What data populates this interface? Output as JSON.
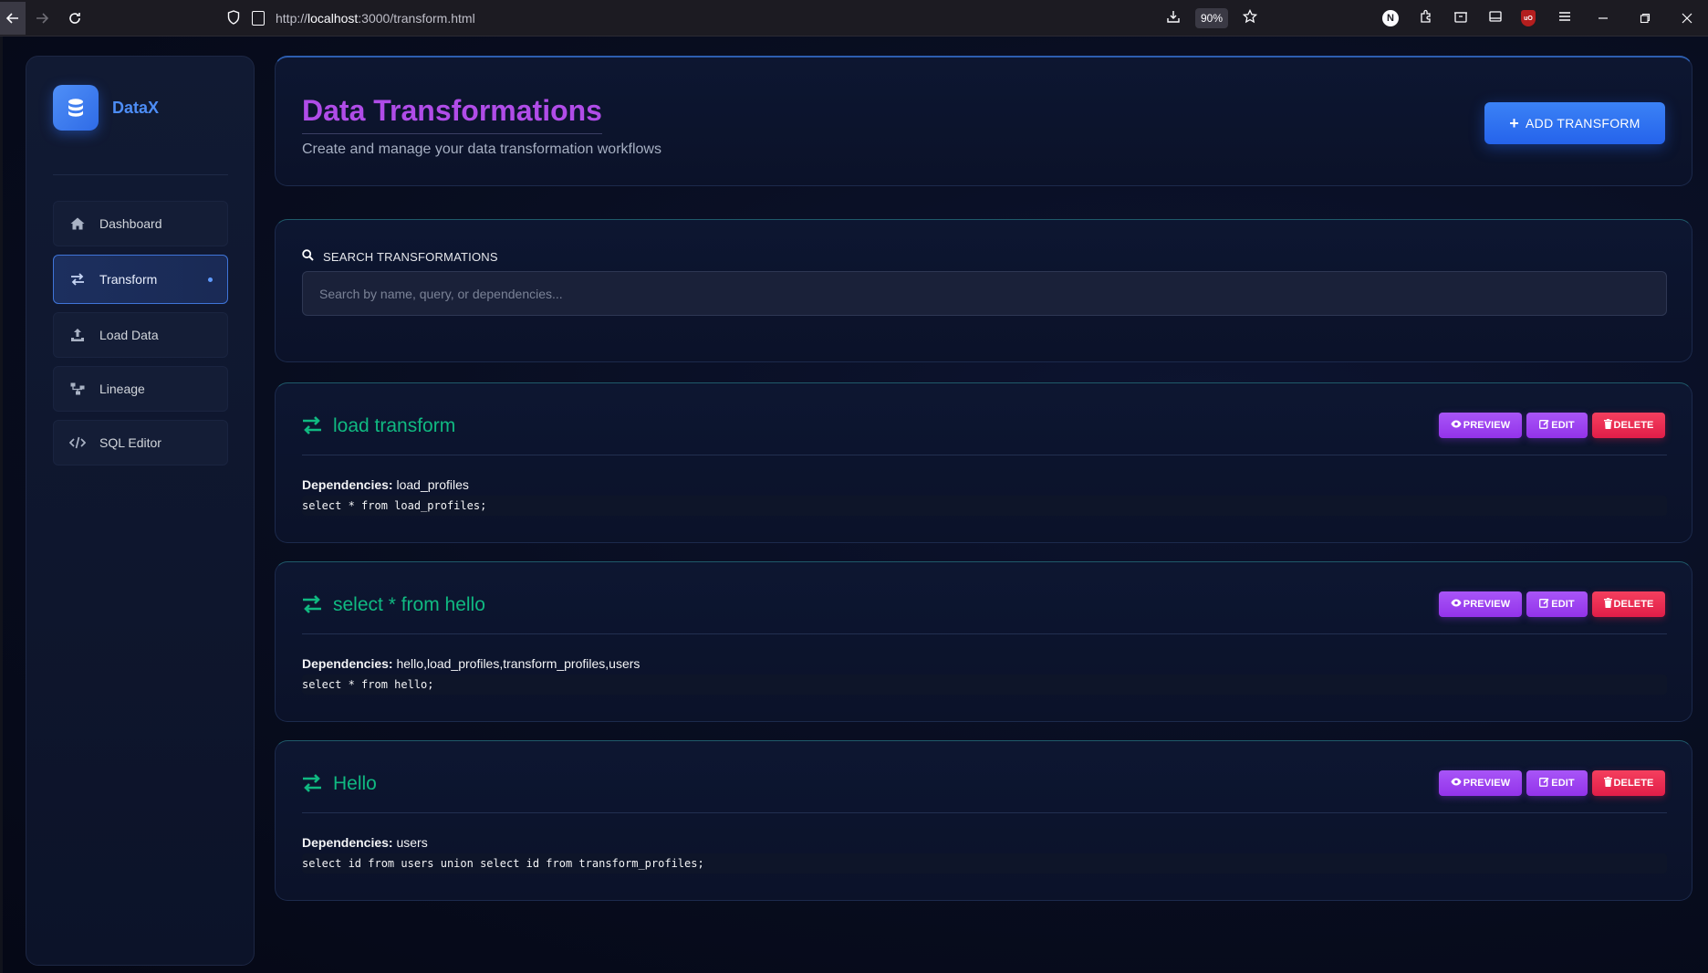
{
  "browser": {
    "url_prefix": "http://",
    "url_host": "localhost",
    "url_path": ":3000/transform.html",
    "zoom": "90%"
  },
  "brand": {
    "name": "DataX"
  },
  "sidebar": {
    "items": [
      {
        "label": "Dashboard",
        "icon": "home-icon",
        "active": false
      },
      {
        "label": "Transform",
        "icon": "arrows-exchange-icon",
        "active": true
      },
      {
        "label": "Load Data",
        "icon": "upload-icon",
        "active": false
      },
      {
        "label": "Lineage",
        "icon": "sitemap-icon",
        "active": false
      },
      {
        "label": "SQL Editor",
        "icon": "code-icon",
        "active": false
      }
    ]
  },
  "header": {
    "title": "Data Transformations",
    "subtitle": "Create and manage your data transformation workflows",
    "add_button_label": "ADD TRANSFORM"
  },
  "search": {
    "label": "SEARCH TRANSFORMATIONS",
    "placeholder": "Search by name, query, or dependencies...",
    "value": ""
  },
  "transforms": [
    {
      "name": "load transform",
      "dependencies_label": "Dependencies:",
      "dependencies": "load_profiles",
      "query": "select * from load_profiles;"
    },
    {
      "name": "select * from hello",
      "dependencies_label": "Dependencies:",
      "dependencies": "hello,load_profiles,transform_profiles,users",
      "query": "select * from hello;"
    },
    {
      "name": "Hello",
      "dependencies_label": "Dependencies:",
      "dependencies": "users",
      "query": "select id from users union select id from transform_profiles;"
    }
  ],
  "actions": {
    "preview": "PREVIEW",
    "edit": "EDIT",
    "delete": "DELETE"
  },
  "colors": {
    "accent_blue": "#3b82f6",
    "title_purple": "#b04ce8",
    "transform_green": "#10b981",
    "button_purple": "#9333ea",
    "button_red": "#e11d48"
  }
}
